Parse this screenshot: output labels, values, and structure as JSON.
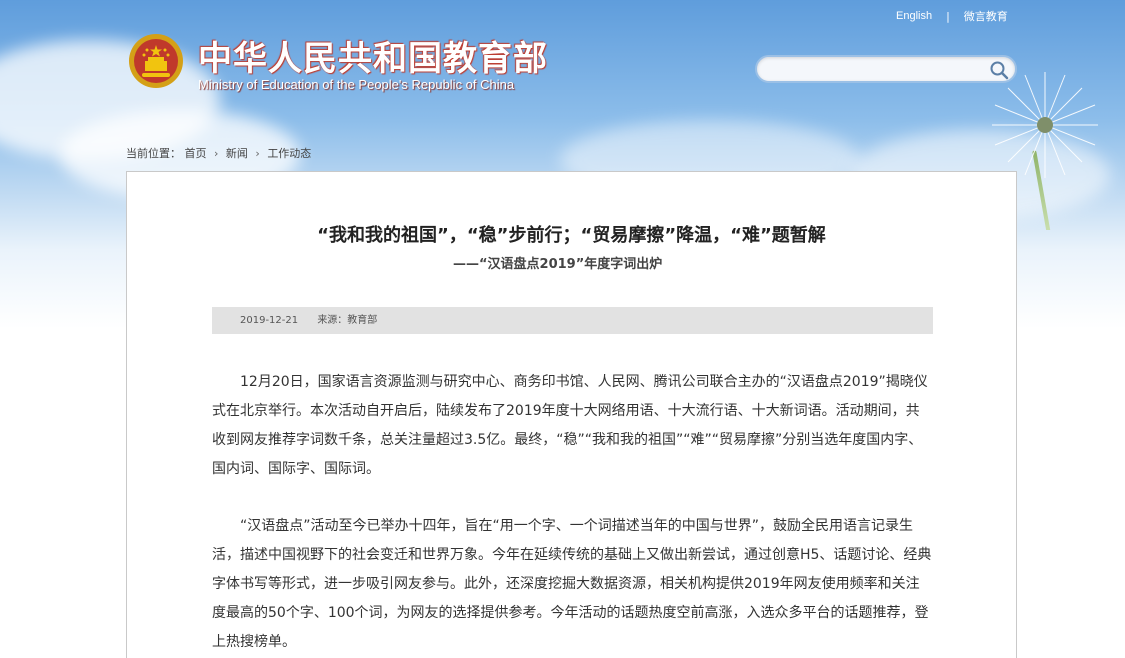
{
  "header": {
    "title_cn": "中华人民共和国教育部",
    "title_en": "Ministry of Education of the People's Republic of China",
    "links": {
      "english": "English",
      "separator": "|",
      "weibo": "微言教育"
    },
    "search": {
      "placeholder": ""
    }
  },
  "breadcrumb": {
    "prefix": "当前位置：",
    "items": [
      "首页",
      "新闻",
      "工作动态"
    ],
    "arrow": "›"
  },
  "article": {
    "title": "“我和我的祖国”，“稳”步前行；“贸易摩擦”降温，“难”题暂解",
    "subtitle": "——“汉语盘点2019”年度字词出炉",
    "date": "2019-12-21",
    "source": "来源：教育部",
    "paragraphs": [
      "12月20日，国家语言资源监测与研究中心、商务印书馆、人民网、腾讯公司联合主办的“汉语盘点2019”揭晓仪式在北京举行。本次活动自开启后，陆续发布了2019年度十大网络用语、十大流行语、十大新词语。活动期间，共收到网友推荐字词数千条，总关注量超过3.5亿。最终，“稳”“我和我的祖国”“难”“贸易摩擦”分别当选年度国内字、国内词、国际字、国际词。",
      "“汉语盘点”活动至今已举办十四年，旨在“用一个字、一个词描述当年的中国与世界”，鼓励全民用语言记录生活，描述中国视野下的社会变迁和世界万象。今年在延续传统的基础上又做出新尝试，通过创意H5、话题讨论、经典字体书写等形式，进一步吸引网友参与。此外，还深度挖掘大数据资源，相关机构提供2019年网友使用频率和关注度最高的50个字、100个词，为网友的选择提供参考。今年活动的话题热度空前高涨，入选众多平台的话题推荐，登上热搜榜单。"
    ]
  },
  "icons": {
    "logo": "national-emblem-icon",
    "search": "search-icon"
  },
  "colors": {
    "sky": "#5f9ddc",
    "title_shadow": "#c0392b",
    "meta_bg": "#e2e2e2"
  }
}
